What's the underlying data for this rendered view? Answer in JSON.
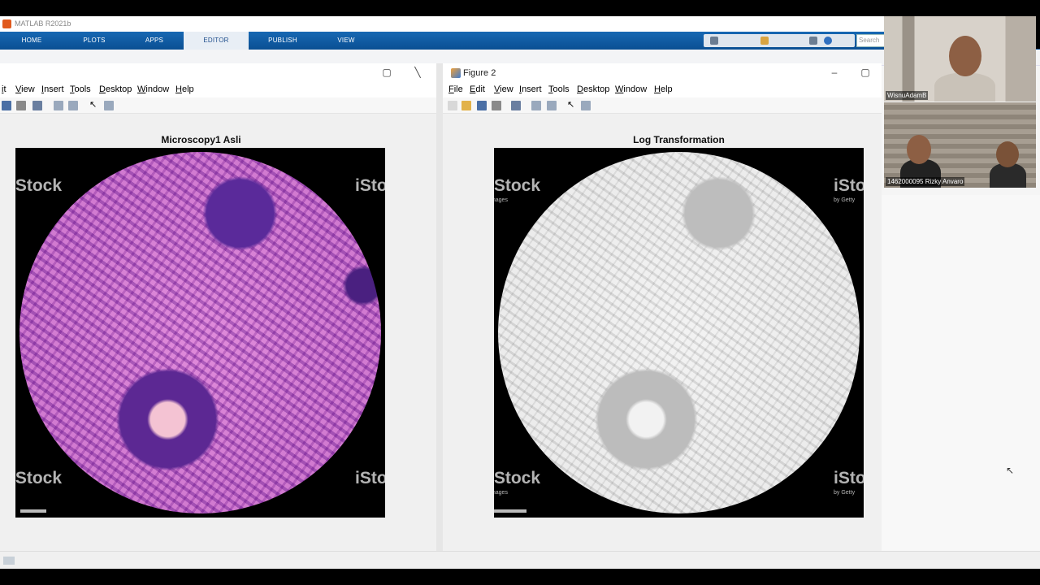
{
  "matlab": {
    "window_title": "MATLAB R2021b",
    "ribbon_tabs": [
      "HOME",
      "PLOTS",
      "APPS",
      "EDITOR",
      "PUBLISH",
      "VIEW"
    ],
    "active_tab": "EDITOR",
    "search_placeholder": "Search"
  },
  "figure1": {
    "menu": [
      "it",
      "View",
      "Insert",
      "Tools",
      "Desktop",
      "Window",
      "Help"
    ],
    "axes_title": "Microscopy1 Asli",
    "colors": "pink-purple H&E stain"
  },
  "figure2": {
    "window_title": "Figure 2",
    "menu": [
      "File",
      "Edit",
      "View",
      "Insert",
      "Tools",
      "Desktop",
      "Window",
      "Help"
    ],
    "axes_title": "Log Transformation",
    "colors": "grayscale"
  },
  "watermark": {
    "brand": "iStock",
    "sub1": "Images",
    "sub2": "by Getty"
  },
  "participants": [
    {
      "name": "WisnuAdamB"
    },
    {
      "name": "1462000095 Rizky Anvaro"
    }
  ],
  "accent_colors": {
    "ribbon": "#0a4f93",
    "figure_bg": "#f0f0f0"
  }
}
